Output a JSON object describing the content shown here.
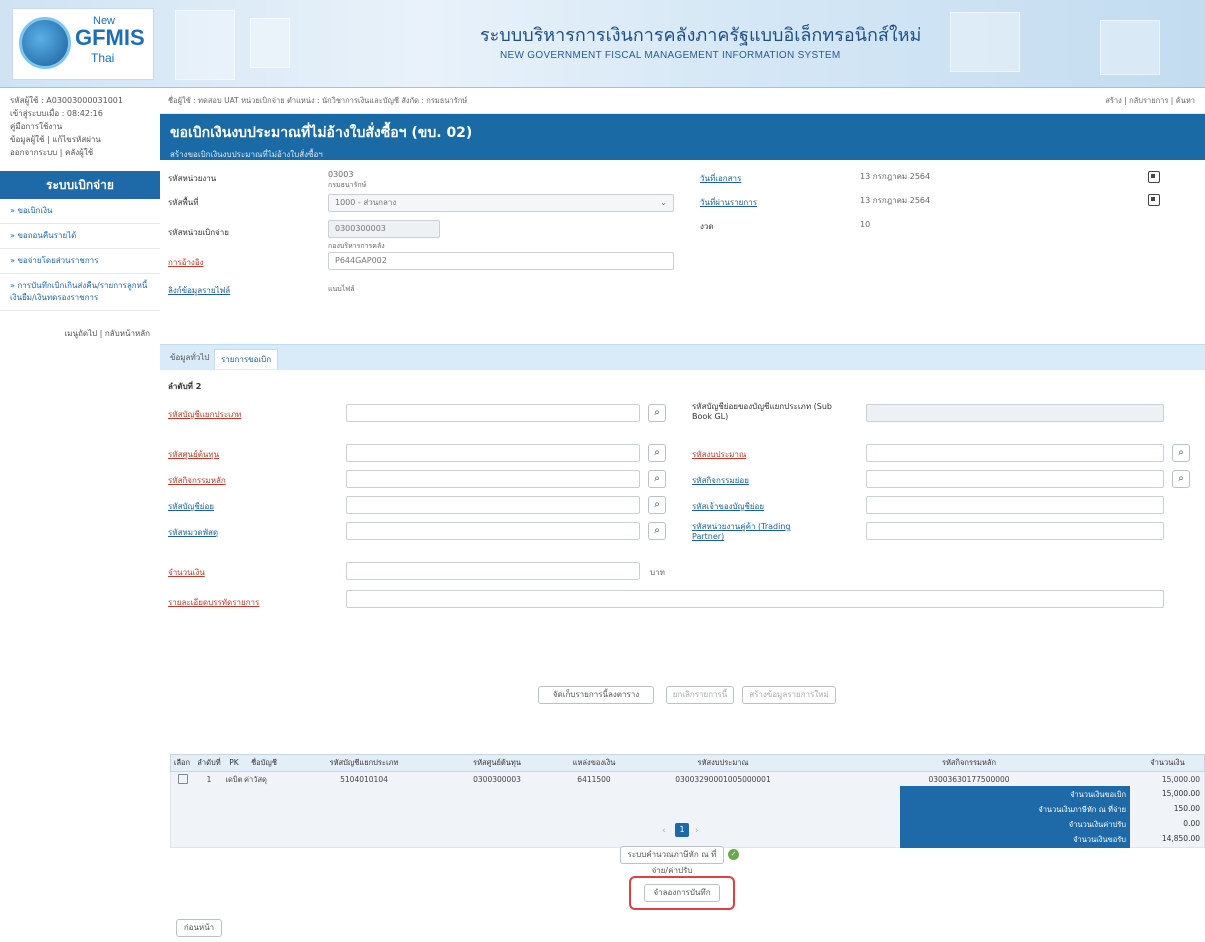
{
  "header": {
    "logo_new": "New",
    "logo_gfmis": "GFMIS",
    "logo_thai": "Thai",
    "title_th": "ระบบบริหารการเงินการคลังภาครัฐแบบอิเล็กทรอนิกส์ใหม่",
    "title_en": "NEW GOVERNMENT FISCAL MANAGEMENT INFORMATION SYSTEM"
  },
  "sidebar": {
    "user_lines": [
      "รหัสผู้ใช้ : A03003000031001",
      "เข้าสู่ระบบเมื่อ : 08:42:16",
      "คู่มือการใช้งาน",
      "ข้อมูลผู้ใช้ | แก้ไขรหัสผ่าน",
      "ออกจากระบบ | คลังผู้ใช้"
    ],
    "title": "ระบบเบิกจ่าย",
    "items": [
      "» ขอเบิกเงิน",
      "» ขอถอนคืนรายได้",
      "» ขอจ่ายโดยส่วนราชการ",
      "» การบันทึกเบิกเกินส่งคืน/รายการลูกหนี้เงินยืม/เงินทดรองราชการ"
    ],
    "back_link": "เมนูถัดไป | กลับหน้าหลัก"
  },
  "topbar": {
    "info": "ชื่อผู้ใช้ : ทดสอบ UAT หน่วยเบิกจ่าย   ตำแหน่ง : นักวิชาการเงินและบัญชี   สังกัด : กรมธนารักษ์",
    "right": "สร้าง | กลับรายการ | ค้นหา"
  },
  "banner": {
    "title": "ขอเบิกเงินงบประมาณที่ไม่อ้างใบสั่งซื้อฯ (ขบ. 02)",
    "subtitle": "สร้างขอเบิกเงินงบประมาณที่ไม่อ้างใบสั่งซื้อฯ"
  },
  "form": {
    "agency_label": "รหัสหน่วยงาน",
    "agency_value": "03003",
    "agency_name": "กรมธนารักษ์",
    "area_label": "รหัสพื้นที่",
    "area_value": "1000 - ส่วนกลาง",
    "disb_label": "รหัสหน่วยเบิกจ่าย",
    "disb_value": "0300300003",
    "disb_name": "กองบริหารการคลัง",
    "ref_label": "การอ้างอิง",
    "ref_value": "P644GAP002",
    "attach_label": "ลิงก์ข้อมูลรายไฟล์",
    "attach_value": "แนบไฟล์",
    "doc_date_label": "วันที่เอกสาร",
    "doc_date_value": "13 กรกฎาคม 2564",
    "post_date_label": "วันที่ผ่านรายการ",
    "post_date_value": "13 กรกฎาคม 2564",
    "period_label": "งวด",
    "period_value": "10"
  },
  "tabs": {
    "general": "ข้อมูลทั่วไป",
    "items": "รายการขอเบิก"
  },
  "detail": {
    "seq_label": "ลำดับที่ 2",
    "budget_acc_label": "รหัสบัญชีแยกประเภท",
    "sub_gl_label": "รหัสบัญชีย่อยของบัญชีแยกประเภท (Sub Book GL)",
    "cost_center_label": "รหัสศูนย์ต้นทุน",
    "budget_code_label": "รหัสงบประมาณ",
    "main_activity_label": "รหัสกิจกรรมหลัก",
    "sub_activity_label": "รหัสกิจกรรมย่อย",
    "sub_acc_label": "รหัสบัญชีย่อย",
    "owner_acc_label": "รหัสเจ้าของบัญชีย่อย",
    "asset_label": "รหัสหมวดพัสดุ",
    "trading_label": "รหัสหน่วยงานคู่ค้า (Trading Partner)",
    "amount_label": "จำนวนเงิน",
    "currency": "บาท",
    "desc_label": "รายละเอียดบรรทัดรายการ"
  },
  "actions": {
    "store": "จัดเก็บรายการนี้ลงตาราง",
    "cancel": "ยกเลิกรายการนี้",
    "new": "สร้างข้อมูลรายการใหม่"
  },
  "table": {
    "headers": [
      "เลือก",
      "ลำดับที่",
      "PK",
      "ชื่อบัญชี",
      "รหัสบัญชีแยกประเภท",
      "รหัสศูนย์ต้นทุน",
      "แหล่งของเงิน",
      "รหัสงบประมาณ",
      "รหัสกิจกรรมหลัก",
      "จำนวนเงิน"
    ],
    "row": {
      "seq": "1",
      "pk": "เดบิต",
      "name": "ค่าวัสดุ",
      "gl": "5104010104",
      "cost_center": "0300300003",
      "fund": "6411500",
      "budget": "03003290001005000001",
      "activity": "03003630177500000",
      "amount": "15,000.00"
    },
    "summary": [
      {
        "label": "จำนวนเงินขอเบิก",
        "value": "15,000.00"
      },
      {
        "label": "จำนวนเงินภาษีหัก ณ ที่จ่าย",
        "value": "150.00"
      },
      {
        "label": "จำนวนเงินค่าปรับ",
        "value": "0.00"
      },
      {
        "label": "จำนวนเงินขอรับ",
        "value": "14,850.00"
      }
    ]
  },
  "pagination": {
    "page": "1"
  },
  "footer": {
    "calc": "ระบบคำนวณภาษีหัก ณ ที่จ่าย/ค่าปรับ",
    "save": "จำลองการบันทึก",
    "back": "ก่อนหน้า"
  }
}
